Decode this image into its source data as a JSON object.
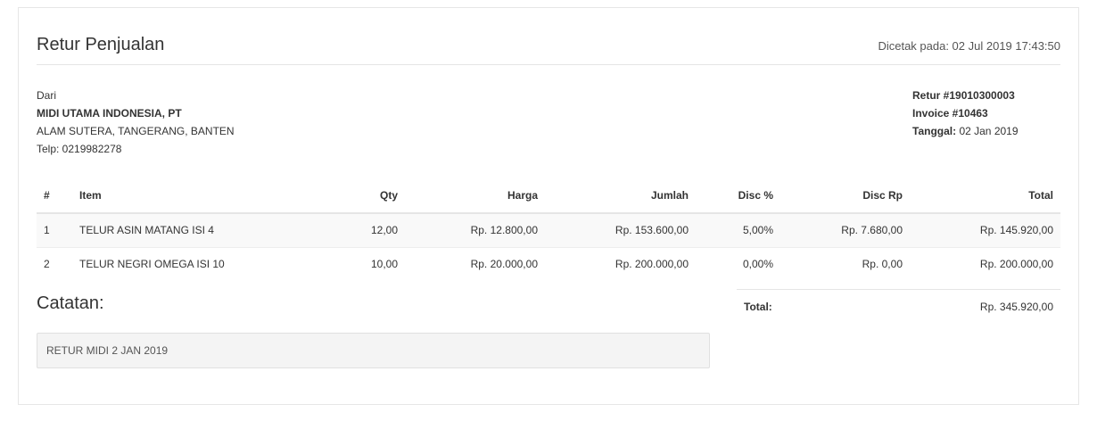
{
  "header": {
    "title": "Retur Penjualan",
    "printed_at": "Dicetak pada: 02 Jul 2019 17:43:50"
  },
  "from": {
    "label": "Dari",
    "company": "MIDI UTAMA INDONESIA, PT",
    "address": "ALAM SUTERA, TANGERANG, BANTEN",
    "phone": "Telp: 0219982278"
  },
  "ref": {
    "retur": "Retur #19010300003",
    "invoice": "Invoice #10463",
    "date_label": "Tanggal:",
    "date_value": "02 Jan 2019"
  },
  "table": {
    "headers": [
      "#",
      "Item",
      "Qty",
      "Harga",
      "Jumlah",
      "Disc %",
      "Disc Rp",
      "Total"
    ],
    "rows": [
      [
        "1",
        "TELUR ASIN MATANG ISI 4",
        "12,00",
        "Rp. 12.800,00",
        "Rp. 153.600,00",
        "5,00%",
        "Rp. 7.680,00",
        "Rp. 145.920,00"
      ],
      [
        "2",
        "TELUR NEGRI OMEGA ISI 10",
        "10,00",
        "Rp. 20.000,00",
        "Rp. 200.000,00",
        "0,00%",
        "Rp. 0,00",
        "Rp. 200.000,00"
      ]
    ]
  },
  "notes": {
    "title": "Catatan:",
    "text": "RETUR MIDI 2 JAN 2019"
  },
  "summary": {
    "total_label": "Total:",
    "total_value": "Rp. 345.920,00"
  }
}
